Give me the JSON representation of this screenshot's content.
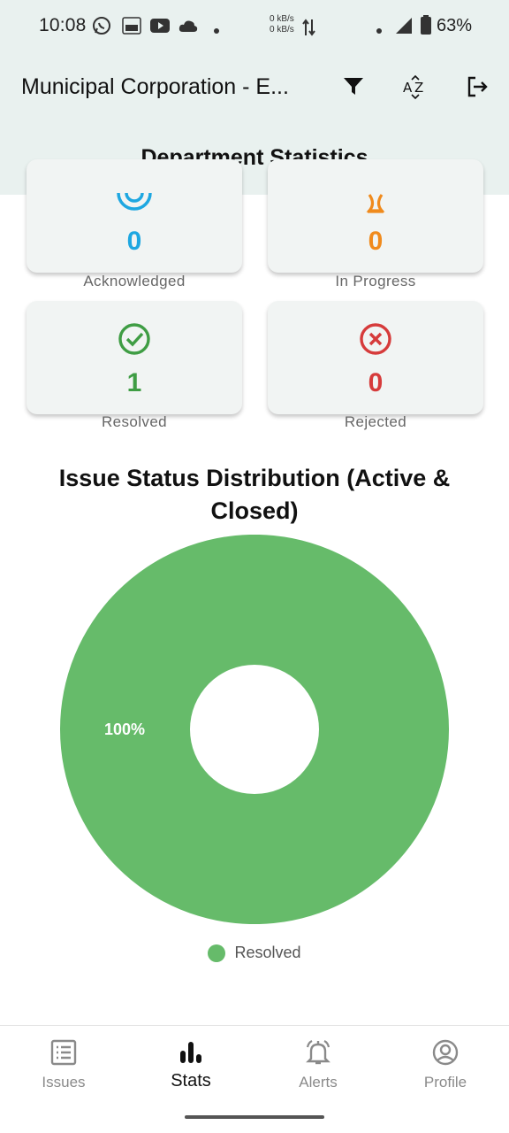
{
  "status_bar": {
    "time": "10:08",
    "speed_up": "0 kB/s",
    "speed_down": "0 kB/s",
    "battery": "63%",
    "icons": [
      "whatsapp-icon",
      "tata-1mg-icon",
      "youtube-icon",
      "cloud-icon",
      "dot-icon",
      "data-arrows-icon",
      "dot-icon",
      "signal-icon",
      "battery-icon"
    ]
  },
  "app_bar": {
    "title": "Municipal Corporation - E...",
    "actions": [
      "filter-icon",
      "sort-az-icon",
      "logout-icon"
    ],
    "page_title": "Department Statistics"
  },
  "stats": [
    {
      "key": "acknowledged",
      "value": "0",
      "label": "Acknowledged",
      "icon": "acknowledged-icon",
      "color": "#1ea7e1"
    },
    {
      "key": "in_progress",
      "value": "0",
      "label": "In Progress",
      "icon": "hourglass-icon",
      "color": "#f08a1c"
    },
    {
      "key": "resolved",
      "value": "1",
      "label": "Resolved",
      "icon": "check-circle-icon",
      "color": "#3f9d44"
    },
    {
      "key": "rejected",
      "value": "0",
      "label": "Rejected",
      "icon": "cancel-circle-icon",
      "color": "#d63b3b"
    }
  ],
  "chart_data": {
    "type": "pie",
    "title": "Issue Status Distribution (Active & Closed)",
    "categories": [
      "Resolved"
    ],
    "values": [
      100
    ],
    "slice_labels": [
      "100%"
    ],
    "colors": [
      "#66bb6a"
    ],
    "hole": true,
    "legend": "bottom-center"
  },
  "bottom_nav": {
    "items": [
      {
        "label": "Issues",
        "icon": "issues-list-icon",
        "active": false
      },
      {
        "label": "Stats",
        "icon": "stats-bar-icon",
        "active": true
      },
      {
        "label": "Alerts",
        "icon": "alerts-bell-icon",
        "active": false
      },
      {
        "label": "Profile",
        "icon": "profile-icon",
        "active": false
      }
    ]
  }
}
